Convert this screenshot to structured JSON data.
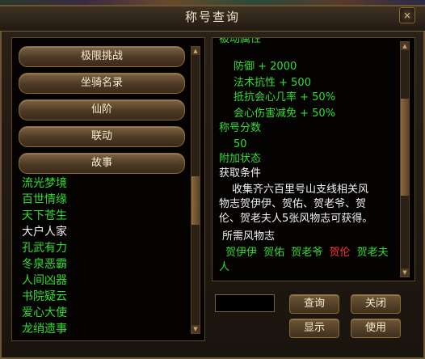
{
  "window": {
    "title": "称号查询",
    "close_glyph": "×"
  },
  "menu": [
    "极限挑战",
    "坐骑名录",
    "仙阶",
    "联动",
    "故事"
  ],
  "stories": [
    {
      "label": "流光梦境",
      "selected": false
    },
    {
      "label": "百世情缘",
      "selected": false
    },
    {
      "label": "天下苍生",
      "selected": false
    },
    {
      "label": "大户人家",
      "selected": true
    },
    {
      "label": "孔武有力",
      "selected": false
    },
    {
      "label": "冬泉恶霸",
      "selected": false
    },
    {
      "label": "人间凶器",
      "selected": false
    },
    {
      "label": "书院疑云",
      "selected": false
    },
    {
      "label": "爱心大使",
      "selected": false
    },
    {
      "label": "龙绡遗事",
      "selected": false
    }
  ],
  "detail": {
    "cut_header": "被动属性",
    "attrs": [
      "防御 + 2000",
      "法术抗性 + 500",
      "抵抗会心几率 + 50%",
      "会心伤害减免 + 50%"
    ],
    "score_label": "称号分数",
    "score_value": "50",
    "extra_state_label": "附加状态",
    "obtain_label": "获取条件",
    "obtain_lines": [
      "收集齐六百里号山支线相关风",
      "物志贺伊伊、贺佑、贺老爷、贺",
      "伦、贺老夫人5张风物志可获得。"
    ],
    "required_label": "所需风物志",
    "required_items": [
      {
        "name": "贺伊伊",
        "owned": true
      },
      {
        "name": "贺佑",
        "owned": true
      },
      {
        "name": "贺老爷",
        "owned": true
      },
      {
        "name": "贺伦",
        "owned": false
      },
      {
        "name": "贺老夫",
        "owned": true
      }
    ],
    "required_overflow": "人"
  },
  "controls": {
    "query_value": "",
    "query_label": "查询",
    "close_label": "关闭",
    "show_label": "显示",
    "use_label": "使用"
  },
  "colors": {
    "owned": "#33dd33",
    "missing": "#ff3333",
    "text": "#f2f2f2"
  }
}
